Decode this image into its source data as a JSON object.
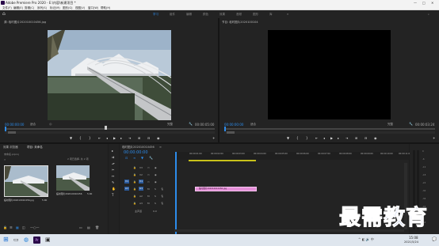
{
  "titlebar": {
    "title": "Adobe Premiere Pro 2020 - E:\\内容\\新建项目 *",
    "minimize": "—",
    "maximize": "□",
    "close": "✕"
  },
  "menu": [
    "文件(F)",
    "编辑(E)",
    "剪辑(C)",
    "序列(S)",
    "标记(M)",
    "图形(G)",
    "视图(V)",
    "窗口(W)",
    "帮助(H)"
  ],
  "workspaces": [
    "学习",
    "组件",
    "编辑",
    "颜色",
    "效果",
    "音频",
    "图形",
    "库"
  ],
  "source": {
    "tab": "源: 临时图片202010010456.jpg",
    "timecode_in": "00:00:00:00",
    "fit": "适合",
    "fraction": "完整",
    "timecode_out": "00:00:05:00"
  },
  "program": {
    "tab": "节目: 临时图片2020100104",
    "timecode_in": "00:00:00:00",
    "fit": "适合",
    "fraction": "完整",
    "timecode_out": "00:00:03:24"
  },
  "project": {
    "tabs": [
      "效果 浏览器",
      "项目: 未命名"
    ],
    "item_count": "2 项已选择, 共 2 项",
    "bin": "未命名.prproj",
    "items": [
      {
        "name": "临时图片202010010456.jpg",
        "duration": "5:00"
      },
      {
        "name": "临时图片202010010456",
        "duration": "5:00"
      }
    ]
  },
  "timeline": {
    "tab": "临时图片202010010456",
    "timecode": "00:00:00:00",
    "ruler": [
      "00:00:01:00",
      "00:00:02:00",
      "00:00:03:00",
      "00:00:04:00",
      "00:00:05:00",
      "00:00:06:00",
      "00:00:07:00",
      "00:00:08:00",
      "00:00:09:00",
      "00:00:10:00",
      "00:00:11:00"
    ],
    "tracks": [
      "V3",
      "V2",
      "V1",
      "A1",
      "A2",
      "A3"
    ],
    "master": "主声道",
    "master_value": "0.0",
    "clip": "临时图片202010010456.jpg"
  },
  "meter_labels": [
    "0",
    "-6",
    "-12",
    "-18",
    "-24",
    "-30",
    "-36",
    "-42",
    "-48",
    "-54"
  ],
  "watermark": "最需教育",
  "taskbar": {
    "time": "15:08",
    "date": "2021/5/24"
  },
  "colors": {
    "accent": "#2d8ceb",
    "clip": "#e58fd8",
    "timeline_bar": "#c9c21a"
  }
}
